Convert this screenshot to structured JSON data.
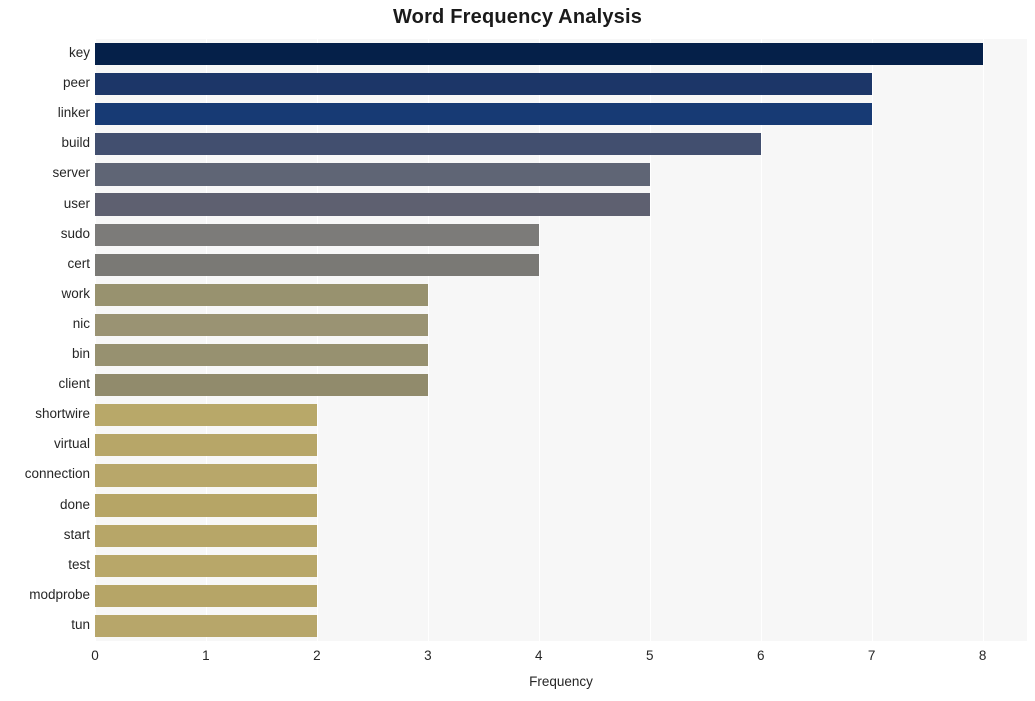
{
  "chart_data": {
    "type": "bar",
    "orientation": "horizontal",
    "title": "Word Frequency Analysis",
    "xlabel": "Frequency",
    "ylabel": "",
    "xlim": [
      0,
      8.4
    ],
    "xticks": [
      0,
      1,
      2,
      3,
      4,
      5,
      6,
      7,
      8
    ],
    "xtick_labels": [
      "0",
      "1",
      "2",
      "3",
      "4",
      "5",
      "6",
      "7",
      "8"
    ],
    "grid": "vertical-white",
    "legend": "none",
    "plot_background": "#f7f7f7",
    "figure_background": "#ffffff",
    "categories": [
      "key",
      "peer",
      "linker",
      "build",
      "server",
      "user",
      "sudo",
      "cert",
      "work",
      "nic",
      "bin",
      "client",
      "shortwire",
      "virtual",
      "connection",
      "done",
      "start",
      "test",
      "modprobe",
      "tun"
    ],
    "values": [
      8,
      7,
      7,
      6,
      5,
      5,
      4,
      4,
      3,
      3,
      3,
      3,
      2,
      2,
      2,
      2,
      2,
      2,
      2,
      2
    ],
    "bar_colors": [
      "#052049",
      "#1c3668",
      "#173a74",
      "#424f6f",
      "#5f6575",
      "#5e6070",
      "#7c7b79",
      "#7a7975",
      "#98926f",
      "#9a9373",
      "#979170",
      "#918b6c",
      "#b8a869",
      "#b7a668",
      "#b8a76a",
      "#b6a566",
      "#b7a668",
      "#b8a769",
      "#b6a567",
      "#b7a66a"
    ]
  }
}
